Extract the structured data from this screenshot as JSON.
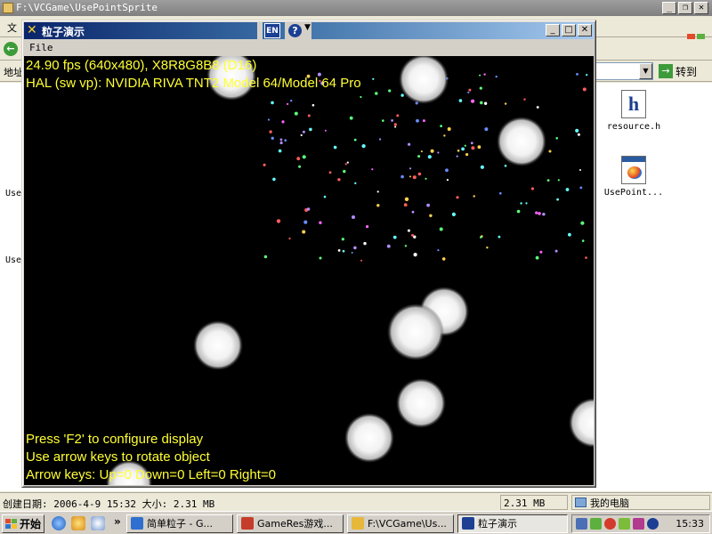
{
  "explorer": {
    "title": "F:\\VCGame\\UsePointSprite",
    "menu_first": "文",
    "address_label": "地址",
    "go_label": "转到",
    "left_text": [
      "Use",
      "Use"
    ],
    "files": [
      {
        "name": "resource.h",
        "icon": "header-file-icon"
      },
      {
        "name": "UsePoint...",
        "icon": "exe-file-icon"
      }
    ],
    "status": {
      "info": "创建日期: 2006-4-9 15:32 大小: 2.31 MB",
      "size": "2.31 MB",
      "location": "我的电脑"
    }
  },
  "app": {
    "title": "粒子演示",
    "ime": "EN",
    "menu": [
      "File"
    ],
    "hud": {
      "fps": "24.90 fps (640x480), X8R8G8B8 (D16)",
      "device": "HAL (sw vp): NVIDIA RIVA TNT2 Model 64/Model 64 Pro",
      "hint1": "Press 'F2' to configure display",
      "hint2": "Use arrow keys to rotate object",
      "keys": "Arrow keys: Up=0 Down=0 Left=0 Right=0"
    }
  },
  "taskbar": {
    "start_label": "开始",
    "more": "»",
    "tasks": [
      {
        "label": "简单粒子 - G...",
        "active": false,
        "icon_color": "#2f6fd0"
      },
      {
        "label": "GameRes游戏...",
        "active": false,
        "icon_color": "#c63c2b"
      },
      {
        "label": "F:\\VCGame\\Us...",
        "active": false,
        "icon_color": "#e7b739"
      },
      {
        "label": "粒子演示",
        "active": true,
        "icon_color": "#1c3f94"
      }
    ],
    "clock": "15:33"
  },
  "colors": {
    "hud_text": "#ffff33",
    "titlebar_start": "#0a246a",
    "titlebar_end": "#a6caf0"
  }
}
